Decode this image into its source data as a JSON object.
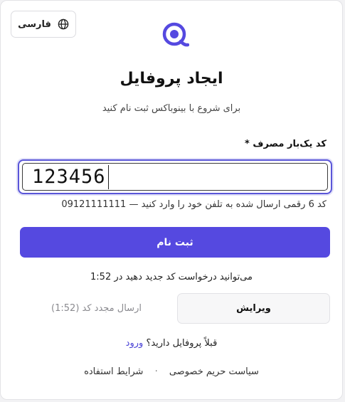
{
  "language_button": {
    "label": "فارسی",
    "icon": "globe-icon"
  },
  "logo": {
    "icon": "brand-logo",
    "color": "#5549e0"
  },
  "header": {
    "title": "ایجاد پروفایل",
    "subtitle": "برای شروع با بینوباکس ثبت نام کنید"
  },
  "otp_field": {
    "label": "کد یک‌بار مصرف",
    "required_mark": "*",
    "value": "123456",
    "hint": "کد 6 رقمی ارسال شده به تلفن خود را وارد کنید — 09121111111"
  },
  "submit_button": {
    "label": "ثبت نام",
    "color": "#5549e0"
  },
  "resend_info": "می‌توانید درخواست کد جدید دهید در 1:52",
  "edit_button": {
    "label": "ویرایش"
  },
  "resend_button": {
    "label": "ارسال مجدد کد (1:52)"
  },
  "login_prompt": {
    "text": "قبلاً پروفایل دارید؟",
    "link": "ورود"
  },
  "footer": {
    "privacy": "سیاست حریم خصوصی",
    "separator": "·",
    "terms": "شرایط استفاده"
  }
}
